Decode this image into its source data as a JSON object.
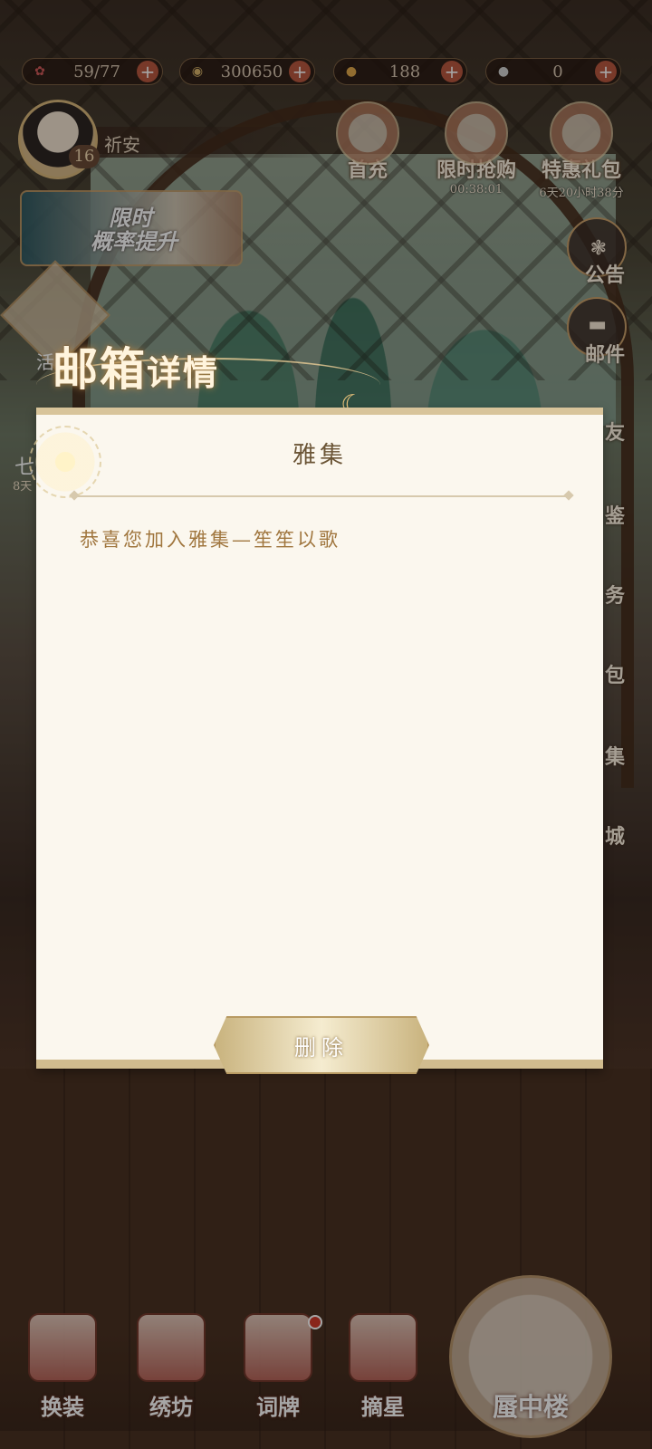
{
  "resources": [
    {
      "name": "stamina",
      "value": "59/77",
      "plus": "+"
    },
    {
      "name": "coins",
      "value": "300650",
      "plus": "+"
    },
    {
      "name": "gold",
      "value": "188",
      "plus": "+"
    },
    {
      "name": "pearl",
      "value": "0",
      "plus": "+"
    }
  ],
  "player": {
    "name": "祈安",
    "level": "16"
  },
  "shortcuts": [
    {
      "label": "首充",
      "timer": ""
    },
    {
      "label": "限时抢购",
      "timer": "00:38:01"
    },
    {
      "label": "特惠礼包",
      "timer": "6天20小时38分"
    }
  ],
  "event_banner": {
    "line1": "限时",
    "line2": "概率提升"
  },
  "side_menu": [
    {
      "label": "公告"
    },
    {
      "label": "邮件"
    }
  ],
  "side_menu_partial": [
    "友",
    "鉴",
    "务",
    "包",
    "集",
    "城"
  ],
  "left_partial": {
    "label1": "活",
    "label2": "七",
    "label3": "8天"
  },
  "modal": {
    "title_main": "邮箱",
    "title_small": "详情",
    "mail_title": "雅集",
    "mail_body": "恭喜您加入雅集—笙笙以歌",
    "delete_label": "删除"
  },
  "bottom_nav": [
    {
      "label": "换装"
    },
    {
      "label": "绣坊"
    },
    {
      "label": "词牌"
    },
    {
      "label": "摘星"
    }
  ],
  "bottom_main": {
    "label": "蜃中楼"
  },
  "colors": {
    "panel_bg": "#fbf7ee",
    "panel_border": "#d8c49a",
    "accent_gold": "#c9a06b",
    "body_text": "#a0763e",
    "plus_button": "#b8583f"
  }
}
